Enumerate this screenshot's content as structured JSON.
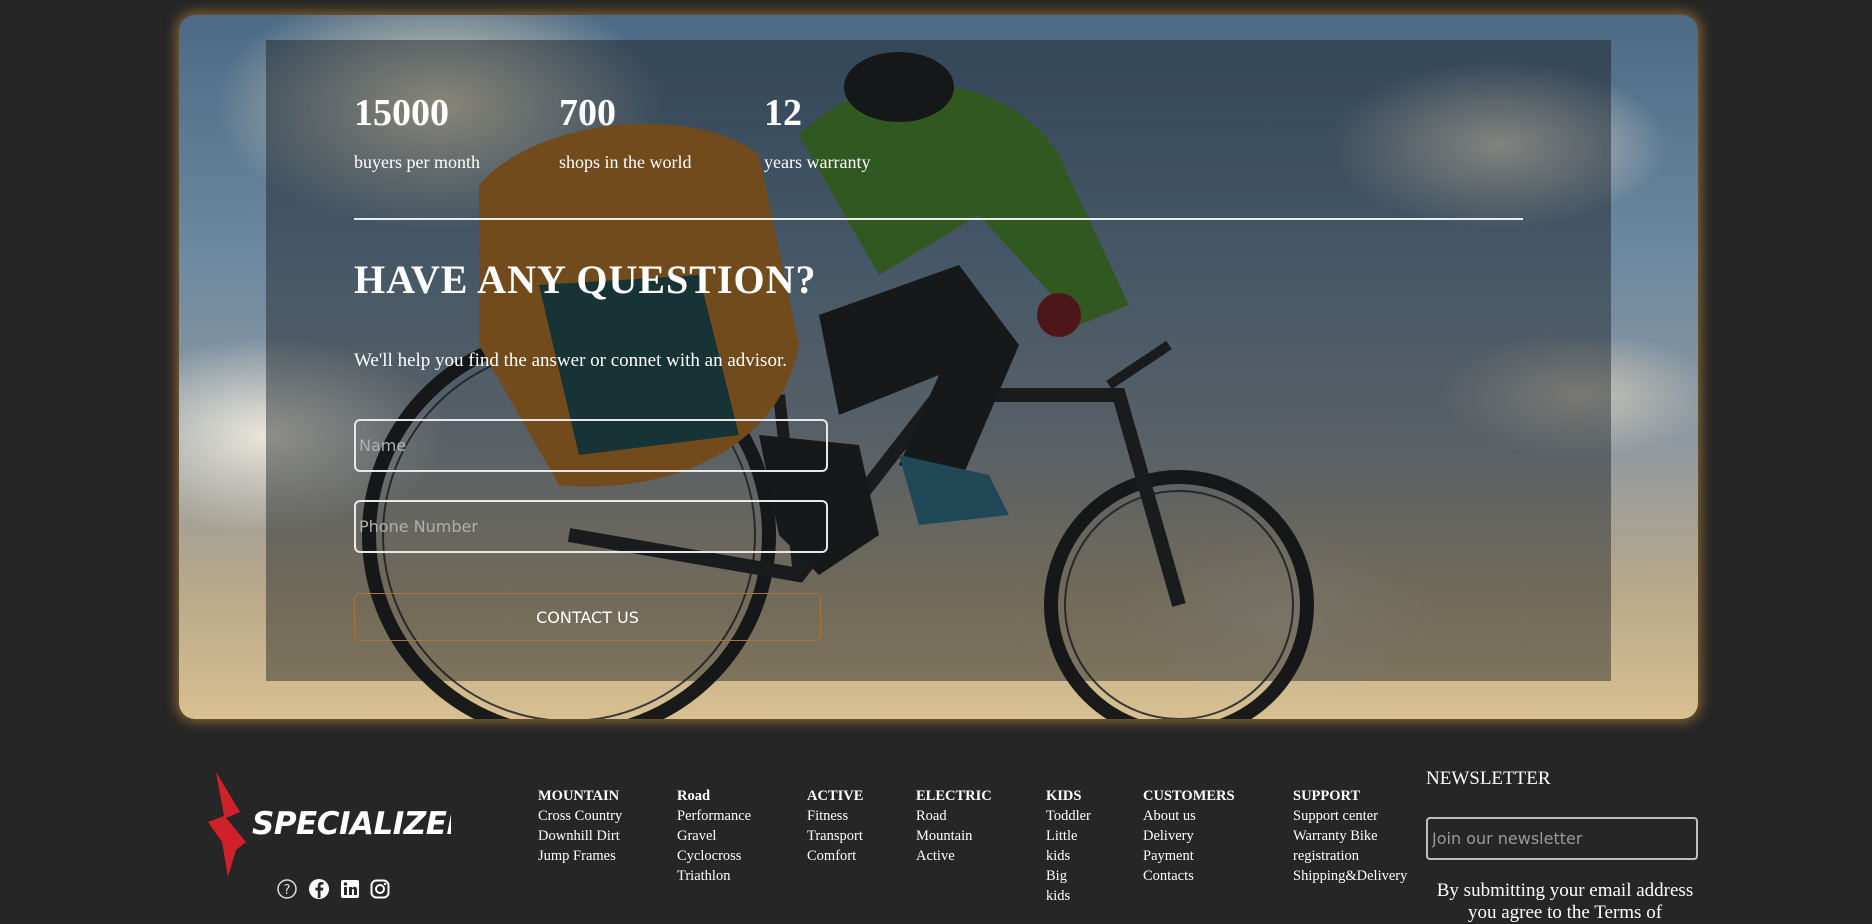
{
  "stats": [
    {
      "value": "15000",
      "label": "buyers per month"
    },
    {
      "value": "700",
      "label": "shops in the world"
    },
    {
      "value": "12",
      "label": "years warranty"
    }
  ],
  "question": {
    "title": "HAVE ANY QUESTION?",
    "subtitle": "We'll help you find the answer or connet with an advisor.",
    "name_placeholder": "Name",
    "phone_placeholder": "Phone Number",
    "button_label": "CONTACT US"
  },
  "brand": {
    "logo_text": "SPECIALIZED",
    "logo_color": "#d0202a"
  },
  "social_icons": [
    "help-icon",
    "facebook-icon",
    "linkedin-icon",
    "instagram-icon"
  ],
  "footer_columns": [
    {
      "title": "MOUNTAIN",
      "links": [
        "Cross Country",
        "Downhill Dirt",
        "Jump Frames"
      ]
    },
    {
      "title": "Road",
      "links": [
        "Performance",
        "Gravel",
        "Cyclocross",
        "Triathlon"
      ]
    },
    {
      "title": "ACTIVE",
      "links": [
        "Fitness",
        "Transport",
        "Comfort"
      ]
    },
    {
      "title": "ELECTRIC",
      "links": [
        "Road",
        "Mountain",
        "Active"
      ]
    },
    {
      "title": "KIDS",
      "links": [
        "Toddler",
        "Little",
        "kids",
        "Big",
        "kids"
      ]
    },
    {
      "title": "CUSTOMERS",
      "links": [
        "About us",
        "Delivery",
        "Payment",
        "Contacts"
      ]
    },
    {
      "title": "SUPPORT",
      "links": [
        "Support center",
        "Warranty Bike",
        "registration",
        "Shipping&Delivery"
      ]
    }
  ],
  "newsletter": {
    "title": "NEWSLETTER",
    "placeholder": "Join our newsletter",
    "note": "By submitting your email address you agree to the Terms of"
  },
  "colors": {
    "accent_border": "#a8743a",
    "glow": "#cc963c",
    "background": "#262626"
  }
}
